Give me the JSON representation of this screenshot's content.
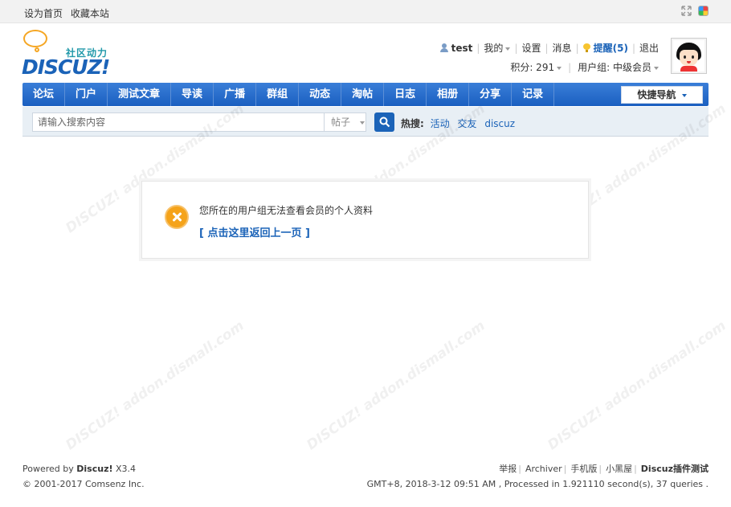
{
  "topbar": {
    "set_home": "设为首页",
    "bookmark": "收藏本站"
  },
  "logo": {
    "slogan": "社区动力",
    "brand": "DISCUZ!"
  },
  "user": {
    "name": "test",
    "mine": "我的",
    "settings": "设置",
    "messages": "消息",
    "notify": "提醒(5)",
    "logout": "退出",
    "credits": "积分: 291",
    "group": "用户组: 中级会员"
  },
  "nav": {
    "items": [
      "论坛",
      "门户",
      "测试文章",
      "导读",
      "广播",
      "群组",
      "动态",
      "淘帖",
      "日志",
      "相册",
      "分享",
      "记录"
    ],
    "quick_nav": "快捷导航"
  },
  "search": {
    "placeholder": "请输入搜索内容",
    "type": "帖子",
    "hot_label": "热搜:",
    "hot_words": [
      "活动",
      "交友",
      "discuz"
    ]
  },
  "message": {
    "text": "您所在的用户组无法查看会员的个人资料",
    "back_link": "[ 点击这里返回上一页 ]"
  },
  "footer": {
    "powered_prefix": "Powered by",
    "powered_brand": "Discuz!",
    "powered_version": "X3.4",
    "copyright": "© 2001-2017 Comsenz Inc.",
    "links": [
      "举报",
      "Archiver",
      "手机版",
      "小黑屋"
    ],
    "site_name": "Discuz插件测试",
    "stats": "GMT+8, 2018-3-12 09:51 AM , Processed in 1.921110 second(s), 37 queries ."
  }
}
